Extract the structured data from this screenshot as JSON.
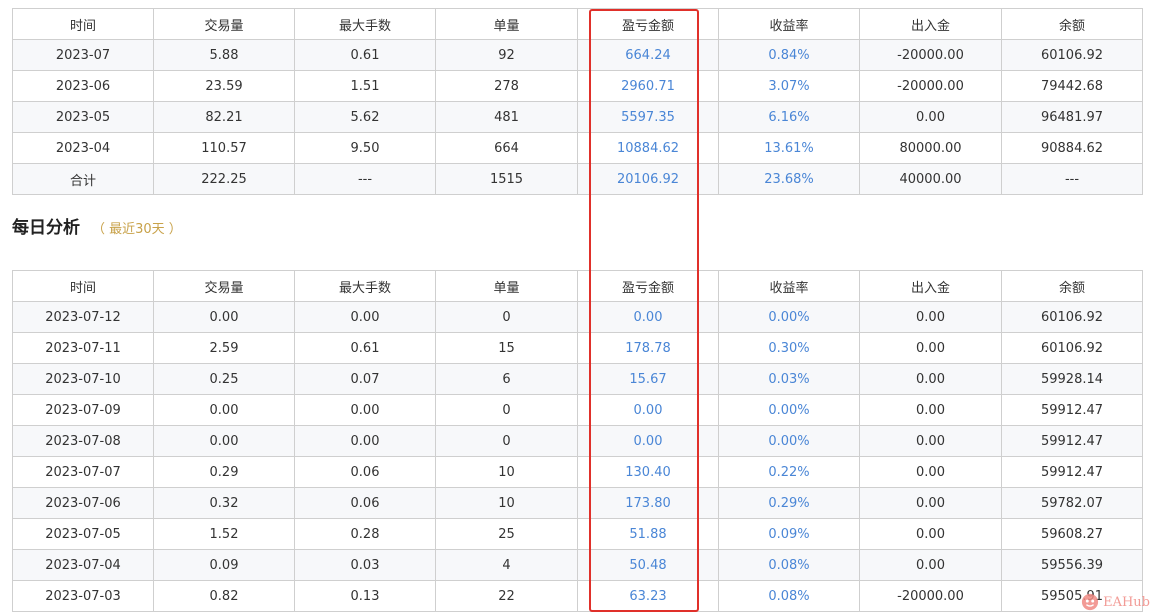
{
  "columns": [
    "时间",
    "交易量",
    "最大手数",
    "单量",
    "盈亏金额",
    "收益率",
    "出入金",
    "余额"
  ],
  "monthly_rows": [
    [
      "2023-07",
      "5.88",
      "0.61",
      "92",
      "664.24",
      "0.84%",
      "-20000.00",
      "60106.92"
    ],
    [
      "2023-06",
      "23.59",
      "1.51",
      "278",
      "2960.71",
      "3.07%",
      "-20000.00",
      "79442.68"
    ],
    [
      "2023-05",
      "82.21",
      "5.62",
      "481",
      "5597.35",
      "6.16%",
      "0.00",
      "96481.97"
    ],
    [
      "2023-04",
      "110.57",
      "9.50",
      "664",
      "10884.62",
      "13.61%",
      "80000.00",
      "90884.62"
    ],
    [
      "合计",
      "222.25",
      "---",
      "1515",
      "20106.92",
      "23.68%",
      "40000.00",
      "---"
    ]
  ],
  "daily_section": {
    "title": "每日分析",
    "subtitle": "（ 最近30天 ）"
  },
  "daily_rows": [
    [
      "2023-07-12",
      "0.00",
      "0.00",
      "0",
      "0.00",
      "0.00%",
      "0.00",
      "60106.92"
    ],
    [
      "2023-07-11",
      "2.59",
      "0.61",
      "15",
      "178.78",
      "0.30%",
      "0.00",
      "60106.92"
    ],
    [
      "2023-07-10",
      "0.25",
      "0.07",
      "6",
      "15.67",
      "0.03%",
      "0.00",
      "59928.14"
    ],
    [
      "2023-07-09",
      "0.00",
      "0.00",
      "0",
      "0.00",
      "0.00%",
      "0.00",
      "59912.47"
    ],
    [
      "2023-07-08",
      "0.00",
      "0.00",
      "0",
      "0.00",
      "0.00%",
      "0.00",
      "59912.47"
    ],
    [
      "2023-07-07",
      "0.29",
      "0.06",
      "10",
      "130.40",
      "0.22%",
      "0.00",
      "59912.47"
    ],
    [
      "2023-07-06",
      "0.32",
      "0.06",
      "10",
      "173.80",
      "0.29%",
      "0.00",
      "59782.07"
    ],
    [
      "2023-07-05",
      "1.52",
      "0.28",
      "25",
      "51.88",
      "0.09%",
      "0.00",
      "59608.27"
    ],
    [
      "2023-07-04",
      "0.09",
      "0.03",
      "4",
      "50.48",
      "0.08%",
      "0.00",
      "59556.39"
    ],
    [
      "2023-07-03",
      "0.82",
      "0.13",
      "22",
      "63.23",
      "0.08%",
      "-20000.00",
      "59505.91"
    ]
  ],
  "colors": {
    "value_blue": "#4a86d6",
    "highlight_red": "#e0302a",
    "subtitle_gold": "#c8a24a"
  },
  "watermark": {
    "icon": "eahub-logo-icon",
    "text": "EAHub"
  }
}
